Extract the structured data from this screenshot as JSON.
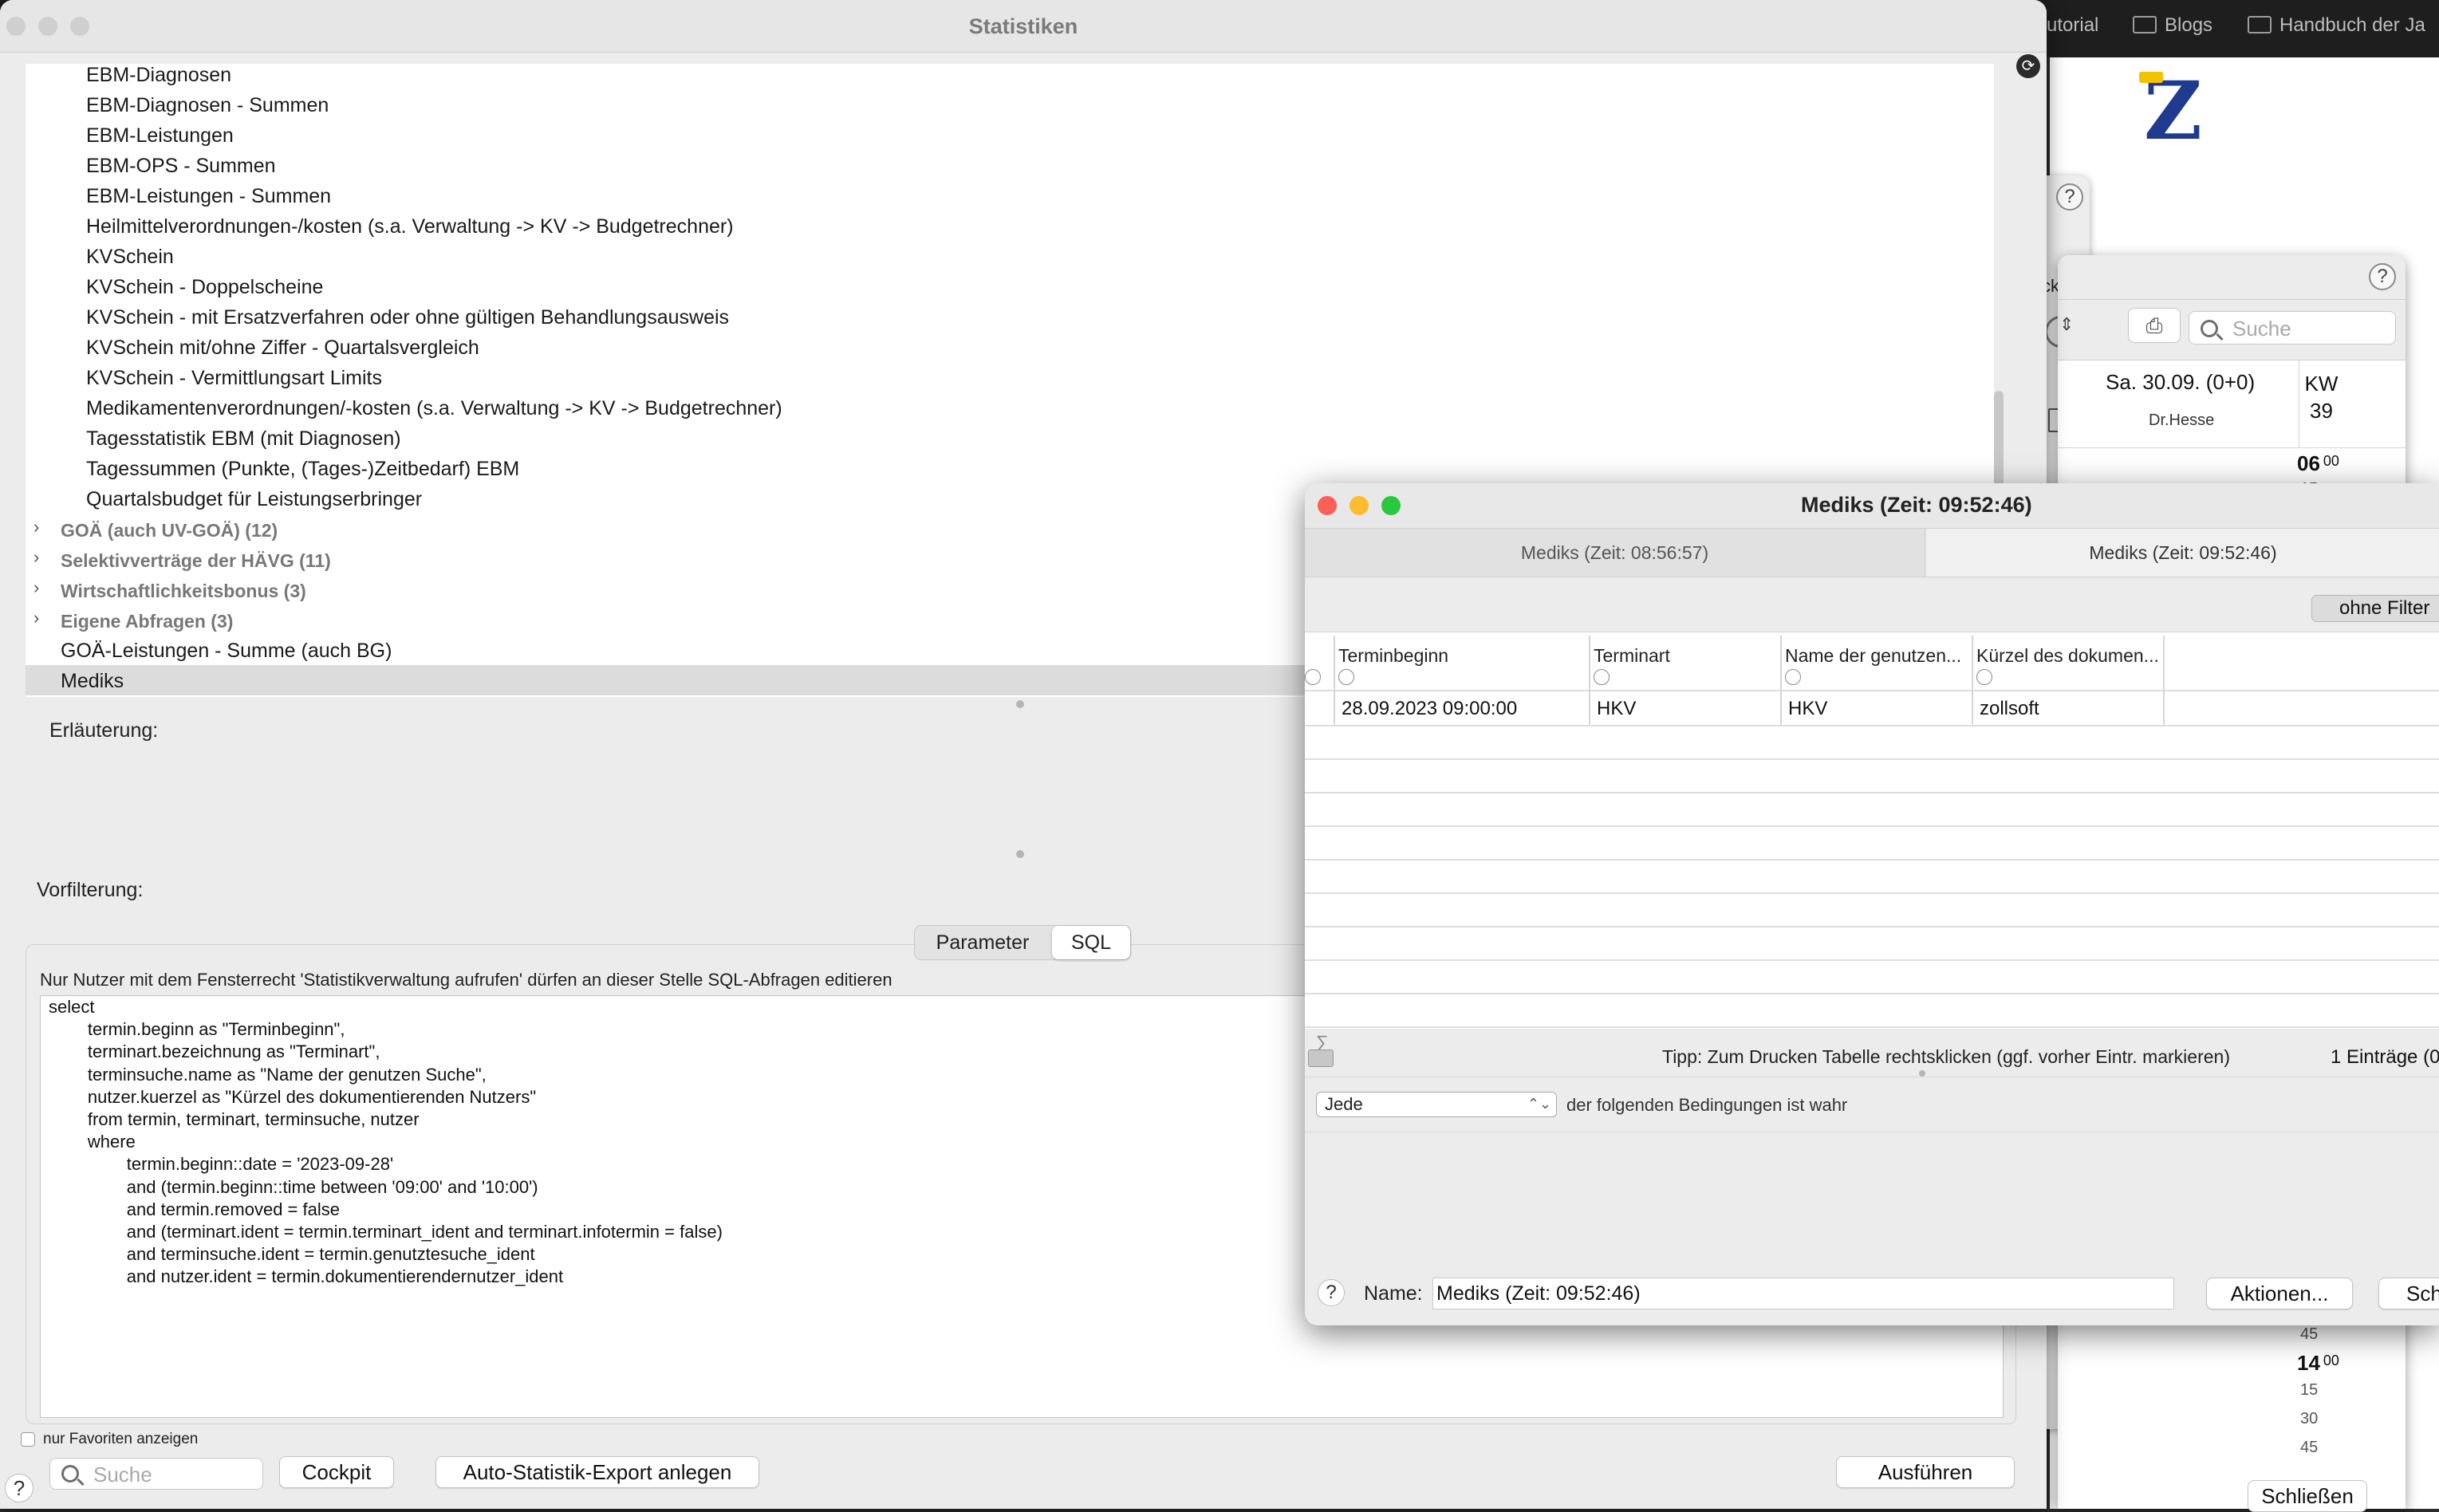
{
  "background": {
    "bookmarks": [
      {
        "label": "utorial",
        "icon": "folder-icon"
      },
      {
        "label": "Blogs",
        "icon": "folder-icon"
      },
      {
        "label": "Handbuch der Ja",
        "icon": "book-icon"
      }
    ]
  },
  "calendar": {
    "help": "?",
    "search_placeholder": "Suche",
    "date_header": "Sa. 30.09. (0+0)",
    "doctor": "Dr.Hesse",
    "kw_label": "KW",
    "kw_number": "39",
    "hours": [
      {
        "h": "06",
        "m": "00"
      },
      {
        "h": "14",
        "m": "00"
      }
    ],
    "minutes_top": [
      "15"
    ],
    "minutes_bottom_pre": [
      "45"
    ],
    "minutes_bottom": [
      "15",
      "30",
      "45"
    ],
    "close_label": "Schließen",
    "side_text": "ck"
  },
  "main": {
    "title": "Statistiken",
    "tree_items": [
      "EBM-Diagnosen",
      "EBM-Diagnosen - Summen",
      "EBM-Leistungen",
      "EBM-OPS - Summen",
      "EBM-Leistungen - Summen",
      "Heilmittelverordnungen-/kosten (s.a. Verwaltung -> KV -> Budgetrechner)",
      "KVSchein",
      "KVSchein - Doppelscheine",
      "KVSchein - mit Ersatzverfahren oder ohne gültigen Behandlungsausweis",
      "KVSchein mit/ohne Ziffer - Quartalsvergleich",
      "KVSchein - Vermittlungsart Limits",
      "Medikamentenverordnungen/-kosten (s.a. Verwaltung -> KV -> Budgetrechner)",
      "Tagesstatistik EBM (mit Diagnosen)",
      "Tagessummen (Punkte, (Tages-)Zeitbedarf) EBM",
      "Quartalsbudget für Leistungserbringer"
    ],
    "tree_groups": [
      "GOÄ (auch UV-GOÄ) (12)",
      "Selektivverträge der HÄVG (11)",
      "Wirtschaftlichkeitsbonus (3)",
      "Eigene Abfragen (3)"
    ],
    "tree_root_items": [
      "GOÄ-Leistungen - Summe (auch BG)",
      "Mediks"
    ],
    "explanation_label": "Erläuterung:",
    "prefilter_label": "Vorfilterung:",
    "tabs": [
      "Parameter",
      "SQL"
    ],
    "active_tab": "SQL",
    "sql_note": "Nur Nutzer mit dem Fensterrecht 'Statistikverwaltung aufrufen' dürfen an dieser Stelle SQL-Abfragen editieren",
    "sql_text": "select\n        termin.beginn as \"Terminbeginn\",\n        terminart.bezeichnung as \"Terminart\",\n        terminsuche.name as \"Name der genutzen Suche\",\n        nutzer.kuerzel as \"Kürzel des dokumentierenden Nutzers\"\n        from termin, terminart, terminsuche, nutzer\n        where\n                termin.beginn::date = '2023-09-28'\n                and (termin.beginn::time between '09:00' and '10:00')\n                and termin.removed = false\n                and (terminart.ident = termin.terminart_ident and terminart.infotermin = false)\n                and terminsuche.ident = termin.genutztesuche_ident\n                and nutzer.ident = termin.dokumentierendernutzer_ident",
    "favorites_label": "nur Favoriten anzeigen",
    "search_placeholder": "Suche",
    "cockpit_label": "Cockpit",
    "auto_export_label": "Auto-Statistik-Export anlegen",
    "run_label": "Ausführen",
    "help": "?"
  },
  "mediks": {
    "title": "Mediks  (Zeit: 09:52:46)",
    "tabs": [
      "Mediks  (Zeit: 08:56:57)",
      "Mediks  (Zeit: 09:52:46)"
    ],
    "no_filter_label": "ohne Filter",
    "columns": [
      "Terminbeginn",
      "Terminart",
      "Name der genutzen...",
      "Kürzel des dokumen..."
    ],
    "rows": [
      [
        "28.09.2023 09:00:00",
        "HKV",
        "HKV",
        "zollsoft"
      ]
    ],
    "sum_symbol": "∑",
    "tip": "Tipp: Zum Drucken Tabelle rechtsklicken (ggf. vorher Eintr. markieren)",
    "count": "1 Einträge (0",
    "condition_select": "Jede",
    "condition_text": "der folgenden Bedingungen ist wahr",
    "help": "?",
    "name_label": "Name:",
    "name_value": "Mediks  (Zeit: 09:52:46)",
    "actions_label": "Aktionen...",
    "close_label": "Schl"
  },
  "colors": {
    "close": "#fe5f57",
    "minimize": "#febc2e",
    "maximize": "#28c840",
    "inactive_light": "#cfcfcf",
    "selection": "#dcdcdc"
  }
}
